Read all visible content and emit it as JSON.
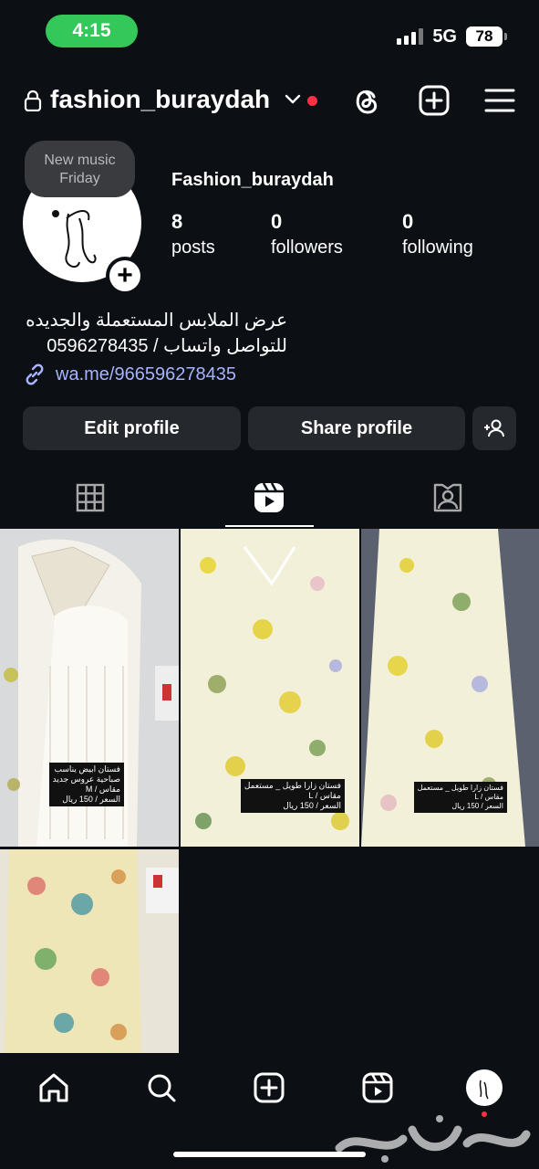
{
  "status": {
    "time": "4:15",
    "network": "5G",
    "battery": "78"
  },
  "header": {
    "username": "fashion_buraydah"
  },
  "profile": {
    "note_line1": "New music",
    "note_line2": "Friday",
    "display_name": "Fashion_buraydah",
    "stats": [
      {
        "value": "8",
        "label": "posts"
      },
      {
        "value": "0",
        "label": "followers"
      },
      {
        "value": "0",
        "label": "following"
      }
    ],
    "bio_line1": "عرض الملابس المستعملة والجديده",
    "bio_line2": "للتواصل واتساب / 0596278435",
    "link": "wa.me/966596278435"
  },
  "buttons": {
    "edit": "Edit profile",
    "share": "Share profile"
  },
  "posts": [
    {
      "caption": "فستان ابيض يناسب\nصباحية عروس جديد\nمقاس / M\nالسعر / 150 ريال"
    },
    {
      "caption": "فستان زارا طويل _ مستعمل\nمقاس / L\nالسعر / 150 ريال"
    },
    {
      "caption": "فستان زارا طويل _ مستعمل\nمقاس / L\nالسعر / 150 ريال"
    },
    {
      "caption": ""
    }
  ],
  "colors": {
    "accent_link": "#a7b3ff",
    "notification": "#ff3040",
    "status_pill": "#34c759",
    "background": "#0c1014",
    "button": "#25292e"
  },
  "icons": [
    "lock-icon",
    "chevron-down-icon",
    "threads-icon",
    "plus-box-icon",
    "menu-icon",
    "add-story-icon",
    "link-icon",
    "add-person-icon",
    "grid-tab-icon",
    "reels-tab-icon",
    "tagged-tab-icon",
    "home-icon",
    "search-icon",
    "create-icon",
    "reels-icon"
  ]
}
